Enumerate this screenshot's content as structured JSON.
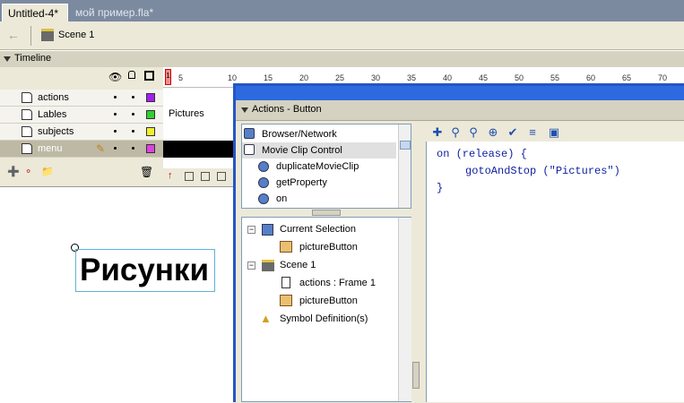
{
  "doc_tabs": [
    "Untitled-4*",
    "мой пример.fla*"
  ],
  "toolbar": {
    "scene_label": "Scene 1"
  },
  "timeline": {
    "title": "Timeline",
    "ruler_numbers": [
      "1",
      "5",
      "10",
      "15",
      "20",
      "25",
      "30",
      "35",
      "40",
      "45",
      "50",
      "55",
      "60",
      "65",
      "70"
    ],
    "layers": [
      {
        "name": "actions",
        "color": "#a020f0"
      },
      {
        "name": "Lables",
        "color": "#30d030"
      },
      {
        "name": "subjects",
        "color": "#f0f030"
      },
      {
        "name": "menu",
        "color": "#e040e0"
      }
    ],
    "frame_label": "Pictures"
  },
  "stage": {
    "text": "Рисунки"
  },
  "actions_panel": {
    "title": "Actions - Button",
    "toolbox_items": [
      "Browser/Network",
      "Movie Clip Control",
      "duplicateMovieClip",
      "getProperty",
      "on"
    ],
    "tree": {
      "current_selection": "Current Selection",
      "picture_button_1": "pictureButton",
      "scene": "Scene 1",
      "actions_frame": "actions : Frame 1",
      "picture_button_2": "pictureButton",
      "symbol_definitions": "Symbol Definition(s)"
    },
    "code_lines": [
      "on (release) {",
      "gotoAndStop (\"Pictures\")",
      "}"
    ]
  }
}
